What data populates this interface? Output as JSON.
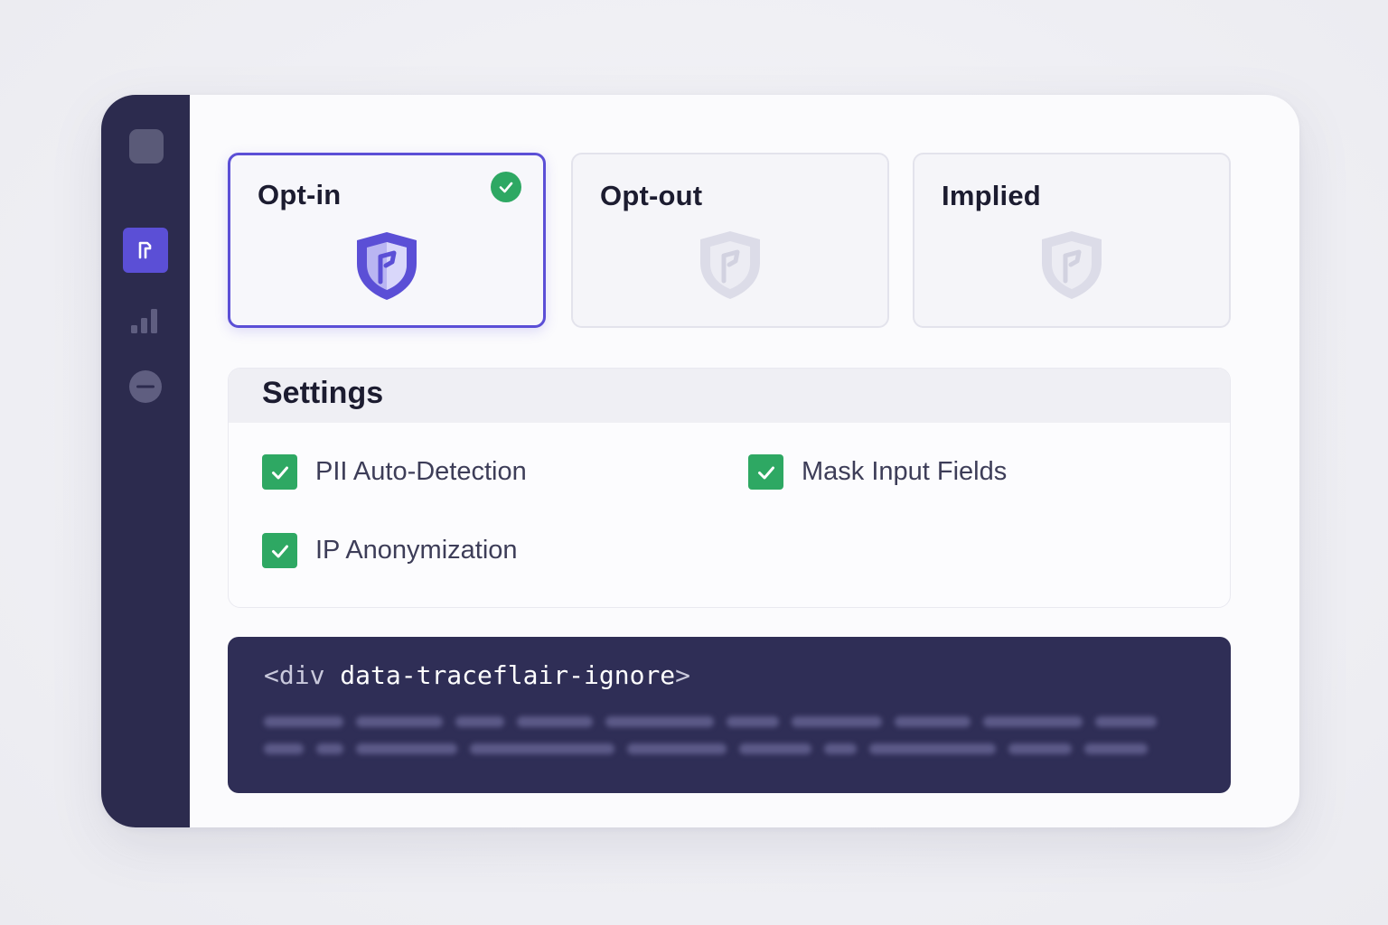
{
  "consent_modes": [
    {
      "label": "Opt-in",
      "selected": true
    },
    {
      "label": "Opt-out",
      "selected": false
    },
    {
      "label": "Implied",
      "selected": false
    }
  ],
  "settings": {
    "title": "Settings",
    "options": [
      {
        "label": "PII Auto-Detection",
        "checked": true
      },
      {
        "label": "Mask Input Fields",
        "checked": true
      },
      {
        "label": "IP Anonymization",
        "checked": true
      }
    ]
  },
  "code": {
    "tag_open": "<div",
    "attribute": " data-traceflair-ignore",
    "tag_close": ">"
  },
  "colors": {
    "accent": "#5b4fd6",
    "success": "#2ea863",
    "sidebar": "#2c2b4e",
    "code_bg": "#2f2e56"
  },
  "icons": {
    "sidebar": [
      "app-logo",
      "privacy-icon",
      "bar-chart-icon",
      "minus-circle-icon"
    ],
    "card": "shield-icon",
    "selected": "check-circle-icon",
    "checkbox": "checkmark-icon"
  }
}
